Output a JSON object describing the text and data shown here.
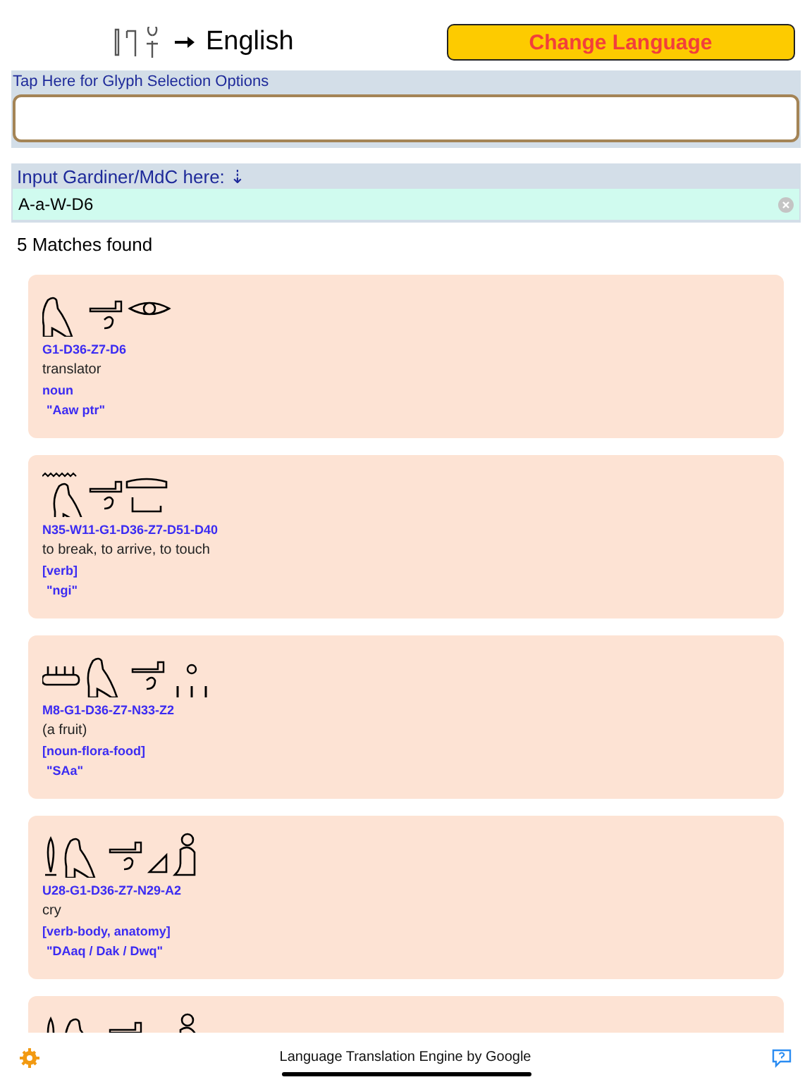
{
  "header": {
    "target_language": "English",
    "change_button": "Change Language"
  },
  "glyph_bar": {
    "label": "Tap Here for Glyph Selection Options"
  },
  "input": {
    "label": "Input Gardiner/MdC here: ⇣",
    "value": "A-a-W-D6"
  },
  "matches": "5 Matches found",
  "cards": [
    {
      "kind": "entry",
      "code": "G1-D36-Z7-D6",
      "meaning": "translator",
      "category": "noun",
      "transliteration": "\"Aaw ptr\""
    },
    {
      "kind": "entry",
      "code": "N35-W11-G1-D36-Z7-D51-D40",
      "meaning": "to break, to arrive, to touch",
      "category": "[verb]",
      "transliteration": "\"ngi\""
    },
    {
      "kind": "entry",
      "code": "M8-G1-D36-Z7-N33-Z2",
      "meaning": "(a fruit)",
      "category": "[noun-flora-food]",
      "transliteration": "\"SAa\""
    },
    {
      "kind": "entry",
      "code": "U28-G1-D36-Z7-N29-A2",
      "meaning": "cry",
      "category": "[verb-body, anatomy]",
      "transliteration": "\"DAaq / Dak / Dwq\""
    },
    {
      "kind": "cut"
    }
  ],
  "footer": {
    "credit": "Language Translation Engine by Google"
  }
}
